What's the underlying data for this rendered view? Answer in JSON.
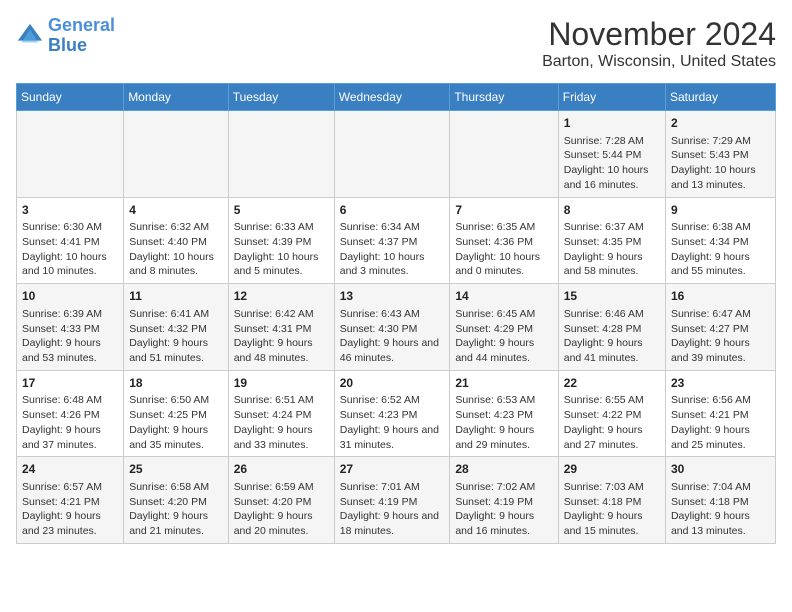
{
  "logo": {
    "line1": "General",
    "line2": "Blue"
  },
  "title": "November 2024",
  "subtitle": "Barton, Wisconsin, United States",
  "days_of_week": [
    "Sunday",
    "Monday",
    "Tuesday",
    "Wednesday",
    "Thursday",
    "Friday",
    "Saturday"
  ],
  "weeks": [
    [
      {
        "day": "",
        "info": ""
      },
      {
        "day": "",
        "info": ""
      },
      {
        "day": "",
        "info": ""
      },
      {
        "day": "",
        "info": ""
      },
      {
        "day": "",
        "info": ""
      },
      {
        "day": "1",
        "info": "Sunrise: 7:28 AM\nSunset: 5:44 PM\nDaylight: 10 hours and 16 minutes."
      },
      {
        "day": "2",
        "info": "Sunrise: 7:29 AM\nSunset: 5:43 PM\nDaylight: 10 hours and 13 minutes."
      }
    ],
    [
      {
        "day": "3",
        "info": "Sunrise: 6:30 AM\nSunset: 4:41 PM\nDaylight: 10 hours and 10 minutes."
      },
      {
        "day": "4",
        "info": "Sunrise: 6:32 AM\nSunset: 4:40 PM\nDaylight: 10 hours and 8 minutes."
      },
      {
        "day": "5",
        "info": "Sunrise: 6:33 AM\nSunset: 4:39 PM\nDaylight: 10 hours and 5 minutes."
      },
      {
        "day": "6",
        "info": "Sunrise: 6:34 AM\nSunset: 4:37 PM\nDaylight: 10 hours and 3 minutes."
      },
      {
        "day": "7",
        "info": "Sunrise: 6:35 AM\nSunset: 4:36 PM\nDaylight: 10 hours and 0 minutes."
      },
      {
        "day": "8",
        "info": "Sunrise: 6:37 AM\nSunset: 4:35 PM\nDaylight: 9 hours and 58 minutes."
      },
      {
        "day": "9",
        "info": "Sunrise: 6:38 AM\nSunset: 4:34 PM\nDaylight: 9 hours and 55 minutes."
      }
    ],
    [
      {
        "day": "10",
        "info": "Sunrise: 6:39 AM\nSunset: 4:33 PM\nDaylight: 9 hours and 53 minutes."
      },
      {
        "day": "11",
        "info": "Sunrise: 6:41 AM\nSunset: 4:32 PM\nDaylight: 9 hours and 51 minutes."
      },
      {
        "day": "12",
        "info": "Sunrise: 6:42 AM\nSunset: 4:31 PM\nDaylight: 9 hours and 48 minutes."
      },
      {
        "day": "13",
        "info": "Sunrise: 6:43 AM\nSunset: 4:30 PM\nDaylight: 9 hours and 46 minutes."
      },
      {
        "day": "14",
        "info": "Sunrise: 6:45 AM\nSunset: 4:29 PM\nDaylight: 9 hours and 44 minutes."
      },
      {
        "day": "15",
        "info": "Sunrise: 6:46 AM\nSunset: 4:28 PM\nDaylight: 9 hours and 41 minutes."
      },
      {
        "day": "16",
        "info": "Sunrise: 6:47 AM\nSunset: 4:27 PM\nDaylight: 9 hours and 39 minutes."
      }
    ],
    [
      {
        "day": "17",
        "info": "Sunrise: 6:48 AM\nSunset: 4:26 PM\nDaylight: 9 hours and 37 minutes."
      },
      {
        "day": "18",
        "info": "Sunrise: 6:50 AM\nSunset: 4:25 PM\nDaylight: 9 hours and 35 minutes."
      },
      {
        "day": "19",
        "info": "Sunrise: 6:51 AM\nSunset: 4:24 PM\nDaylight: 9 hours and 33 minutes."
      },
      {
        "day": "20",
        "info": "Sunrise: 6:52 AM\nSunset: 4:23 PM\nDaylight: 9 hours and 31 minutes."
      },
      {
        "day": "21",
        "info": "Sunrise: 6:53 AM\nSunset: 4:23 PM\nDaylight: 9 hours and 29 minutes."
      },
      {
        "day": "22",
        "info": "Sunrise: 6:55 AM\nSunset: 4:22 PM\nDaylight: 9 hours and 27 minutes."
      },
      {
        "day": "23",
        "info": "Sunrise: 6:56 AM\nSunset: 4:21 PM\nDaylight: 9 hours and 25 minutes."
      }
    ],
    [
      {
        "day": "24",
        "info": "Sunrise: 6:57 AM\nSunset: 4:21 PM\nDaylight: 9 hours and 23 minutes."
      },
      {
        "day": "25",
        "info": "Sunrise: 6:58 AM\nSunset: 4:20 PM\nDaylight: 9 hours and 21 minutes."
      },
      {
        "day": "26",
        "info": "Sunrise: 6:59 AM\nSunset: 4:20 PM\nDaylight: 9 hours and 20 minutes."
      },
      {
        "day": "27",
        "info": "Sunrise: 7:01 AM\nSunset: 4:19 PM\nDaylight: 9 hours and 18 minutes."
      },
      {
        "day": "28",
        "info": "Sunrise: 7:02 AM\nSunset: 4:19 PM\nDaylight: 9 hours and 16 minutes."
      },
      {
        "day": "29",
        "info": "Sunrise: 7:03 AM\nSunset: 4:18 PM\nDaylight: 9 hours and 15 minutes."
      },
      {
        "day": "30",
        "info": "Sunrise: 7:04 AM\nSunset: 4:18 PM\nDaylight: 9 hours and 13 minutes."
      }
    ]
  ]
}
